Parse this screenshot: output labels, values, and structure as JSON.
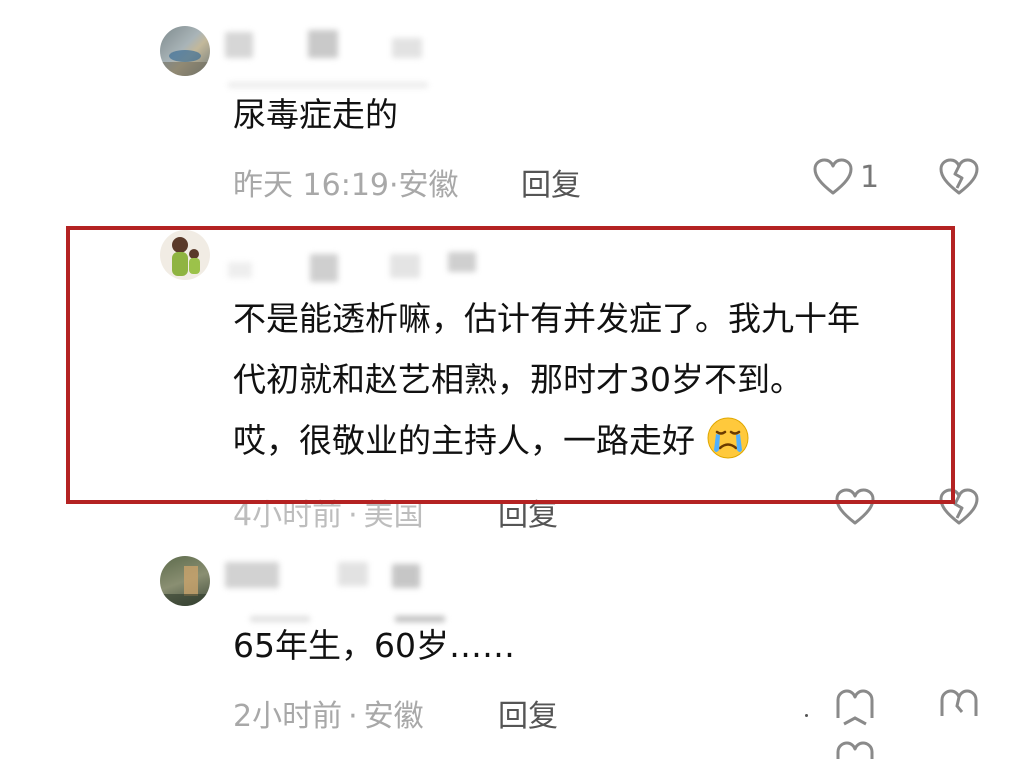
{
  "comments": [
    {
      "text": "尿毒症走的",
      "time": "昨天 16:19",
      "separator": "·",
      "location": "安徽",
      "reply_label": "回复",
      "like_count": "1"
    },
    {
      "lines": [
        "不是能透析嘛，估计有并发症了。我九十年",
        "代初就和赵艺相熟，那时才30岁不到。",
        "哎，很敬业的主持人，一路走好"
      ],
      "time": "4小时前",
      "separator": "·",
      "location": "美国",
      "reply_label": "回复"
    },
    {
      "text": "65年生，60岁……",
      "time": "2小时前",
      "separator": "·",
      "location": "安徽",
      "reply_label": "回复"
    }
  ],
  "icons": {
    "like": "heart-outline-icon",
    "dislike": "broken-heart-icon",
    "emoji": "crying-face-emoji"
  },
  "colors": {
    "highlight_border": "#b42222",
    "meta_text": "#a8a8a8",
    "icon_gray": "#8a8a8a"
  }
}
